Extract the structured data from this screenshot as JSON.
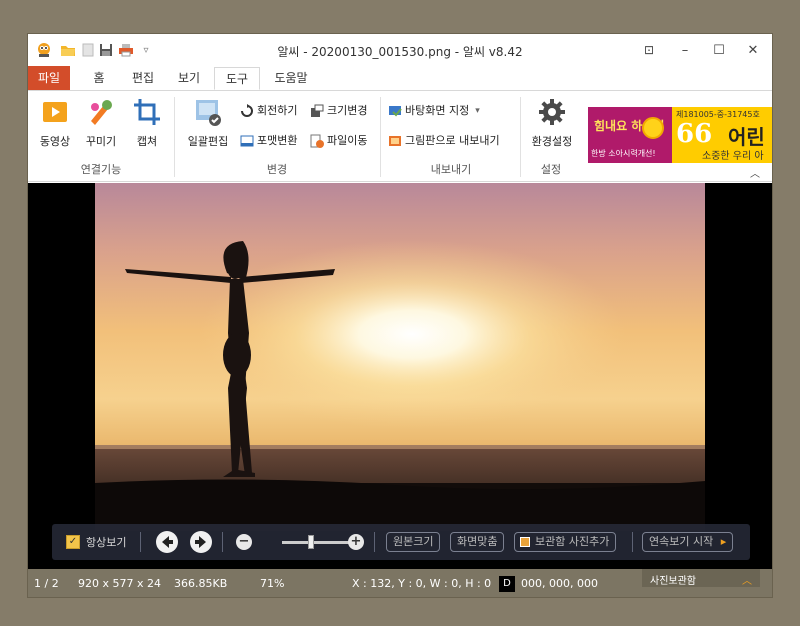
{
  "window": {
    "title": "알씨 - 20200130_001530.png - 알씨 v8.42"
  },
  "quick_access": {
    "icons": [
      "alsee-logo-icon",
      "open-folder-icon",
      "new-icon",
      "save-icon",
      "print-icon",
      "dropdown-icon"
    ],
    "more_glyph": "▿"
  },
  "window_controls": {
    "pin_glyph": "⊡",
    "minimize_glyph": "–",
    "maximize_glyph": "☐",
    "close_glyph": "✕"
  },
  "tabs": [
    {
      "label": "파일"
    },
    {
      "label": "홈"
    },
    {
      "label": "편집"
    },
    {
      "label": "보기"
    },
    {
      "label": "도구"
    },
    {
      "label": "도움말"
    }
  ],
  "ribbon": {
    "groups": {
      "connect": {
        "label": "연결기능",
        "buttons": [
          {
            "label": "동영상",
            "icon": "video-icon"
          },
          {
            "label": "꾸미기",
            "icon": "decorate-icon"
          },
          {
            "label": "캡쳐",
            "icon": "crop-capture-icon"
          }
        ]
      },
      "change": {
        "label": "변경",
        "batch": {
          "label": "일괄편집",
          "icon": "batch-edit-icon"
        },
        "rotate": {
          "label": "회전하기",
          "icon": "rotate-icon"
        },
        "resize": {
          "label": "크기변경",
          "icon": "resize-icon"
        },
        "format": {
          "label": "포맷변환",
          "icon": "format-convert-icon"
        },
        "move": {
          "label": "파일이동",
          "icon": "file-move-icon"
        }
      },
      "export": {
        "label": "내보내기",
        "wallpaper": {
          "label": "바탕화면 지정",
          "icon": "wallpaper-icon",
          "arrow": "▾"
        },
        "board": {
          "label": "그림판으로 내보내기",
          "icon": "paint-export-icon"
        }
      },
      "settings": {
        "label": "설정",
        "env": {
          "label": "환경설정",
          "icon": "gear-icon"
        }
      }
    },
    "collapse_glyph": "︿"
  },
  "ad": {
    "brand": "힘내요 하소리",
    "sub": "한방 소아시력개선!",
    "reg": "제181005-중-31745호",
    "quote": "66",
    "headline": "어린",
    "slogan": "소중한 우리 아"
  },
  "viewer_toolbar": {
    "always_on_top": "항상보기",
    "check_glyph": "✓",
    "prev_glyph": "◀",
    "next_glyph": "▶",
    "zoom_out_glyph": "−",
    "zoom_in_glyph": "+",
    "original_size": "원본크기",
    "fit_screen": "화면맞춤",
    "add_to_album": "보관함 사진추가",
    "slideshow": "연속보기 시작",
    "slideshow_arrow": "▸"
  },
  "status": {
    "index": "1 / 2",
    "dimensions": "920 x 577 x 24",
    "filesize": "366.85KB",
    "zoom": "71%",
    "coords": "X : 132, Y : 0, W : 0, H : 0",
    "d_badge": "D",
    "color_value": "000, 000, 000",
    "album_label": "사진보관함",
    "album_arrow": "︿"
  },
  "colors": {
    "file_tab": "#d34d2a",
    "statusbar": "#7c7563",
    "ad_yellow": "#ffcc00",
    "ad_magenta": "#b01a6a"
  }
}
